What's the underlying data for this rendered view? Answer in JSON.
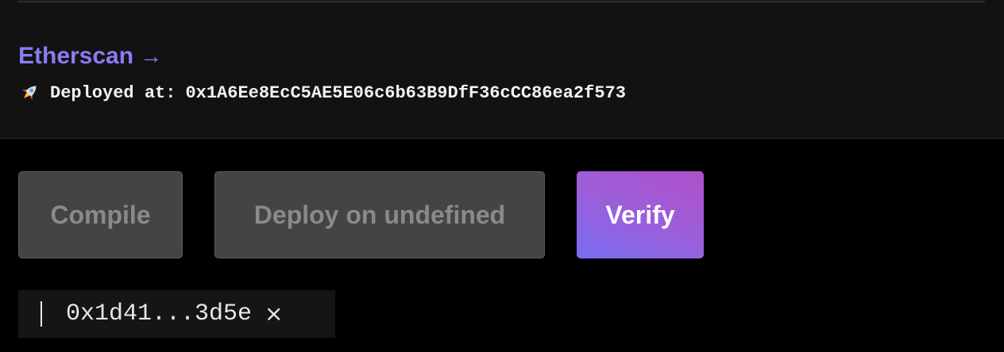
{
  "contract_panel": {
    "etherscan_label": "Etherscan",
    "arrow_glyph": "→",
    "deployed_label": "Deployed at:",
    "deployed_address": "0x1A6Ee8EcC5AE5E06c6b63B9DfF36cCC86ea2f573",
    "rocket_icon": "rocket-icon"
  },
  "actions": {
    "compile_label": "Compile",
    "deploy_label": "Deploy on undefined",
    "verify_label": "Verify"
  },
  "wallet_chip": {
    "address_short": "0x1d41...3d5e",
    "close_glyph": "×"
  },
  "colors": {
    "accent": "#8a7cf4",
    "verify_gradient_start": "#7b6cf2",
    "verify_gradient_end": "#b04fc9",
    "disabled_button_bg": "#444444",
    "disabled_button_text": "#8a8a8a"
  }
}
